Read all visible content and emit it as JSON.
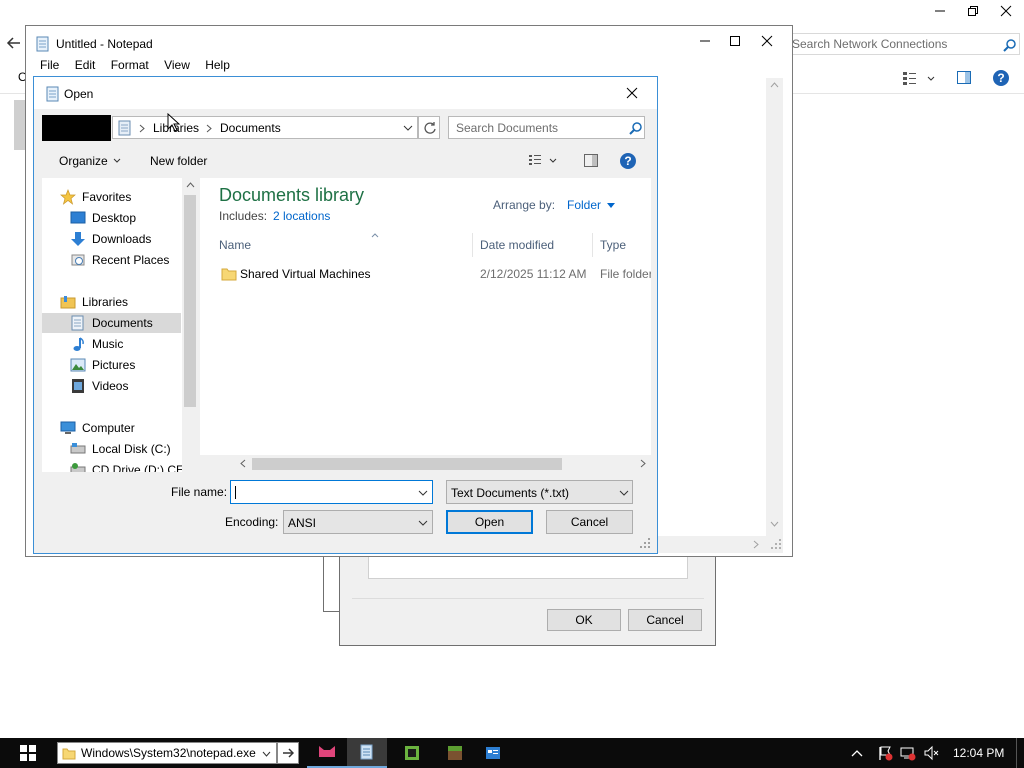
{
  "background_window": {
    "search_placeholder": "Search Network Connections",
    "toolbar_fragment": "O"
  },
  "back_dialog": {
    "ok_label": "OK",
    "cancel_label": "Cancel"
  },
  "notepad": {
    "title": "Untitled - Notepad",
    "menu": [
      "File",
      "Edit",
      "Format",
      "View",
      "Help"
    ]
  },
  "open_dialog": {
    "title": "Open",
    "breadcrumb": [
      "Libraries",
      "Documents"
    ],
    "search_placeholder": "Search Documents",
    "organize_label": "Organize",
    "new_folder_label": "New folder",
    "nav": {
      "favorites": "Favorites",
      "desktop": "Desktop",
      "downloads": "Downloads",
      "recent_places": "Recent Places",
      "libraries": "Libraries",
      "documents": "Documents",
      "music": "Music",
      "pictures": "Pictures",
      "videos": "Videos",
      "computer": "Computer",
      "local_disk": "Local Disk (C:)",
      "cd_drive": "CD Drive (D:) CEN"
    },
    "library_title": "Documents library",
    "includes_label": "Includes:",
    "includes_link": "2 locations",
    "arrange_by_label": "Arrange by:",
    "arrange_by_value": "Folder",
    "columns": {
      "name": "Name",
      "date_modified": "Date modified",
      "type": "Type"
    },
    "files": [
      {
        "name": "Shared Virtual Machines",
        "date_modified": "2/12/2025 11:12 AM",
        "type": "File folder"
      }
    ],
    "file_name_label": "File name:",
    "file_name_value": "",
    "file_type_value": "Text Documents (*.txt)",
    "encoding_label": "Encoding:",
    "encoding_value": "ANSI",
    "open_label": "Open",
    "cancel_label": "Cancel"
  },
  "taskbar": {
    "address_value": "Windows\\System32\\notepad.exe",
    "clock": "12:04 PM"
  },
  "colors": {
    "accent": "#0078d7",
    "library_title": "#1e7145",
    "link": "#0066cc",
    "taskbar": "#0b0b0b"
  }
}
